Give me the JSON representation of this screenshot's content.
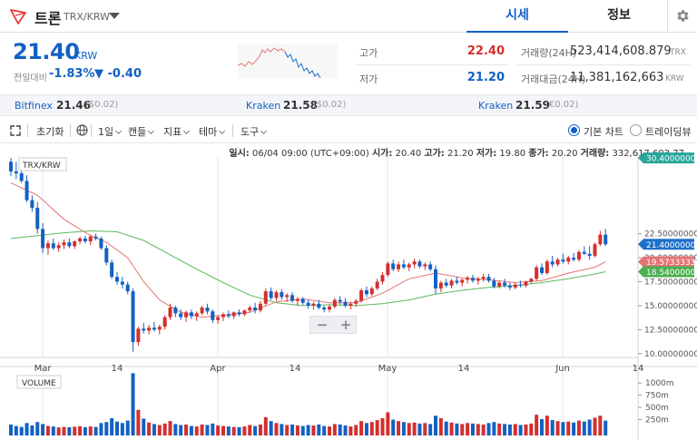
{
  "header": {
    "coin_name": "트론",
    "pair": "TRX/KRW",
    "tab_quote": "시세",
    "tab_info": "정보",
    "icons": {
      "coin": "tron-logo-icon",
      "caret": "caret-down-icon",
      "settings": "gear-icon"
    }
  },
  "summary": {
    "price": "21.40",
    "unit": "KRW",
    "prev_label": "전일대비",
    "change_pct": "-1.83%",
    "change_abs": "▼ -0.40",
    "high_label": "고가",
    "high_value": "22.40",
    "low_label": "저가",
    "low_value": "21.20",
    "volume_label": "거래량(24H)",
    "volume_value": "523,414,608.879",
    "volume_unit": "TRX",
    "amount_label": "거래대금(24H)",
    "amount_value": "11,381,162,663",
    "amount_unit": "KRW",
    "colors": {
      "up": "#d32f2f",
      "down": "#1261c4"
    }
  },
  "exchanges": [
    {
      "name": "Bitfinex",
      "price": "21.46",
      "diff": "($0.02)"
    },
    {
      "name": "Kraken",
      "price": "21.58",
      "diff": "($0.02)"
    },
    {
      "name": "Kraken",
      "price": "21.59",
      "diff": "(€0.02)"
    }
  ],
  "toolbar": {
    "reset": "초기화",
    "interval": "1일",
    "candle": "캔들",
    "indicator": "지표",
    "theme": "테마",
    "tools": "도구",
    "basic_chart": "기본 차트",
    "tradingview": "트레이딩뷰",
    "icons": {
      "expand": "expand-icon",
      "globe": "globe-icon"
    }
  },
  "ohlc": {
    "date_label": "일시:",
    "date": "06/04 09:00 (UTC+09:00)",
    "open_label": "시가:",
    "open": "20.40",
    "high_label": "고가:",
    "high": "21.20",
    "low_label": "저가:",
    "low": "19.80",
    "close_label": "종가:",
    "close": "20.20",
    "vol_label": "거래량:",
    "vol": "332,617,693.77"
  },
  "chart_data": {
    "type": "candlestick",
    "series_label": "TRX/KRW",
    "volume_label": "VOLUME",
    "y_ticks": [
      "22.50000000",
      "20.00000000",
      "17.50000000",
      "15.00000000",
      "12.50000000",
      "10.00000000"
    ],
    "y_range": [
      9.6,
      30.6
    ],
    "x_labels": [
      "Mar",
      "14",
      "Apr",
      "14",
      "May",
      "14",
      "Jun",
      "14"
    ],
    "price_tags": [
      {
        "label": "30.40000000",
        "value": 30.4,
        "color": "#26a69a"
      },
      {
        "label": "21.40000000",
        "value": 21.4,
        "color": "#1e70c9"
      },
      {
        "label": "19.57333333",
        "value": 19.57,
        "color": "#e57373"
      },
      {
        "label": "18.54000000",
        "value": 18.54,
        "color": "#4caf50"
      }
    ],
    "volume_ticks": [
      "1000m",
      "750m",
      "500m",
      "250m"
    ],
    "volume_range": [
      0,
      1300
    ],
    "candles": [
      [
        30.0,
        30.4,
        28.5,
        29.0
      ],
      [
        29.0,
        30.0,
        28.2,
        28.8
      ],
      [
        28.8,
        29.5,
        27.8,
        28.0
      ],
      [
        28.0,
        28.6,
        25.8,
        26.0
      ],
      [
        26.0,
        26.5,
        24.8,
        25.2
      ],
      [
        25.2,
        25.8,
        22.5,
        23.0
      ],
      [
        23.0,
        23.6,
        20.5,
        21.0
      ],
      [
        21.0,
        21.8,
        20.3,
        21.5
      ],
      [
        21.5,
        22.0,
        20.8,
        21.0
      ],
      [
        21.0,
        21.6,
        20.6,
        21.3
      ],
      [
        21.3,
        21.9,
        20.9,
        21.6
      ],
      [
        21.6,
        22.0,
        21.0,
        21.2
      ],
      [
        21.2,
        21.8,
        20.9,
        21.7
      ],
      [
        21.7,
        22.2,
        21.4,
        22.0
      ],
      [
        22.0,
        22.3,
        21.5,
        21.7
      ],
      [
        21.7,
        22.4,
        21.3,
        22.2
      ],
      [
        22.2,
        22.5,
        21.8,
        22.0
      ],
      [
        22.0,
        22.2,
        20.8,
        21.0
      ],
      [
        21.0,
        21.3,
        19.2,
        19.5
      ],
      [
        19.5,
        19.8,
        17.8,
        18.0
      ],
      [
        18.0,
        18.5,
        17.2,
        17.5
      ],
      [
        17.5,
        18.0,
        16.8,
        17.2
      ],
      [
        17.2,
        17.5,
        16.2,
        16.5
      ],
      [
        16.5,
        16.8,
        10.2,
        11.2
      ],
      [
        11.2,
        12.8,
        10.8,
        12.6
      ],
      [
        12.6,
        13.2,
        12.1,
        12.4
      ],
      [
        12.4,
        13.0,
        12.0,
        12.7
      ],
      [
        12.7,
        13.3,
        12.3,
        12.5
      ],
      [
        12.5,
        13.0,
        12.0,
        12.8
      ],
      [
        12.8,
        14.0,
        12.5,
        13.8
      ],
      [
        13.8,
        15.2,
        13.5,
        14.8
      ],
      [
        14.8,
        15.0,
        13.8,
        14.2
      ],
      [
        14.2,
        14.6,
        13.5,
        13.8
      ],
      [
        13.8,
        14.5,
        13.3,
        14.3
      ],
      [
        14.3,
        14.6,
        13.6,
        13.9
      ],
      [
        13.9,
        14.4,
        13.4,
        14.2
      ],
      [
        14.2,
        15.0,
        14.0,
        14.8
      ],
      [
        14.8,
        15.2,
        14.1,
        14.4
      ],
      [
        14.4,
        14.6,
        13.2,
        13.5
      ],
      [
        13.5,
        14.0,
        13.1,
        13.8
      ],
      [
        13.8,
        14.3,
        13.4,
        14.1
      ],
      [
        14.1,
        14.5,
        13.7,
        13.9
      ],
      [
        13.9,
        14.4,
        13.6,
        14.3
      ],
      [
        14.3,
        14.6,
        13.9,
        14.1
      ],
      [
        14.1,
        14.6,
        13.9,
        14.5
      ],
      [
        14.5,
        15.0,
        14.3,
        14.8
      ],
      [
        14.8,
        15.3,
        14.2,
        14.5
      ],
      [
        14.5,
        15.5,
        14.3,
        15.2
      ],
      [
        15.2,
        16.8,
        15.0,
        16.5
      ],
      [
        16.5,
        16.9,
        15.6,
        15.8
      ],
      [
        15.8,
        16.6,
        15.5,
        16.4
      ],
      [
        16.4,
        16.7,
        15.6,
        15.9
      ],
      [
        15.9,
        16.3,
        15.4,
        16.1
      ],
      [
        16.1,
        16.4,
        15.3,
        15.5
      ],
      [
        15.5,
        15.9,
        15.0,
        15.7
      ],
      [
        15.7,
        15.9,
        15.1,
        15.3
      ],
      [
        15.3,
        15.6,
        14.7,
        15.0
      ],
      [
        15.0,
        15.4,
        14.6,
        15.2
      ],
      [
        15.2,
        15.6,
        14.6,
        14.8
      ],
      [
        14.8,
        15.0,
        14.3,
        14.6
      ],
      [
        14.6,
        15.1,
        14.3,
        14.9
      ],
      [
        14.9,
        15.8,
        14.7,
        15.6
      ],
      [
        15.6,
        16.0,
        15.1,
        15.4
      ],
      [
        15.4,
        15.8,
        14.8,
        15.0
      ],
      [
        15.0,
        15.4,
        14.6,
        15.2
      ],
      [
        15.2,
        15.7,
        14.9,
        15.5
      ],
      [
        15.5,
        16.8,
        15.3,
        16.6
      ],
      [
        16.6,
        17.0,
        15.9,
        16.2
      ],
      [
        16.2,
        17.0,
        16.0,
        16.8
      ],
      [
        16.8,
        17.8,
        16.6,
        17.5
      ],
      [
        17.5,
        18.5,
        17.2,
        18.2
      ],
      [
        18.2,
        19.6,
        18.0,
        19.4
      ],
      [
        19.4,
        19.8,
        18.6,
        18.8
      ],
      [
        18.8,
        19.6,
        18.5,
        19.3
      ],
      [
        19.3,
        19.8,
        18.8,
        19.0
      ],
      [
        19.0,
        19.5,
        18.6,
        19.3
      ],
      [
        19.3,
        19.9,
        18.9,
        19.6
      ],
      [
        19.6,
        19.8,
        18.9,
        19.1
      ],
      [
        19.1,
        19.5,
        18.7,
        19.3
      ],
      [
        19.3,
        19.6,
        18.6,
        18.8
      ],
      [
        18.8,
        19.2,
        16.2,
        16.8
      ],
      [
        16.8,
        17.6,
        16.4,
        17.4
      ],
      [
        17.4,
        17.8,
        16.9,
        17.1
      ],
      [
        17.1,
        17.8,
        16.8,
        17.6
      ],
      [
        17.6,
        18.0,
        17.2,
        17.4
      ],
      [
        17.4,
        17.8,
        17.0,
        17.7
      ],
      [
        17.7,
        18.1,
        17.3,
        17.9
      ],
      [
        17.9,
        18.2,
        17.4,
        17.6
      ],
      [
        17.6,
        18.0,
        17.2,
        17.8
      ],
      [
        17.8,
        18.3,
        17.5,
        18.0
      ],
      [
        18.0,
        18.3,
        17.4,
        17.6
      ],
      [
        17.6,
        17.9,
        16.8,
        17.0
      ],
      [
        17.0,
        17.6,
        16.8,
        17.4
      ],
      [
        17.4,
        17.8,
        16.9,
        17.1
      ],
      [
        17.1,
        17.4,
        16.6,
        16.9
      ],
      [
        16.9,
        17.4,
        16.7,
        17.2
      ],
      [
        17.2,
        17.6,
        16.9,
        17.1
      ],
      [
        17.1,
        17.6,
        16.9,
        17.5
      ],
      [
        17.5,
        17.9,
        17.3,
        17.8
      ],
      [
        17.8,
        19.2,
        17.6,
        19.0
      ],
      [
        19.0,
        19.4,
        18.2,
        18.4
      ],
      [
        18.4,
        19.8,
        18.2,
        19.6
      ],
      [
        19.6,
        20.2,
        19.0,
        19.3
      ],
      [
        19.3,
        20.0,
        19.1,
        19.8
      ],
      [
        19.8,
        20.4,
        19.4,
        19.6
      ],
      [
        19.6,
        20.2,
        19.3,
        20.0
      ],
      [
        20.0,
        20.5,
        19.6,
        19.8
      ],
      [
        19.8,
        20.8,
        19.6,
        20.6
      ],
      [
        20.6,
        21.2,
        20.3,
        20.4
      ],
      [
        20.4,
        21.2,
        19.8,
        20.2
      ],
      [
        20.2,
        21.6,
        20.0,
        21.4
      ],
      [
        21.4,
        22.8,
        21.2,
        22.4
      ],
      [
        22.4,
        23.0,
        21.2,
        21.4
      ]
    ],
    "volumes": [
      150,
      120,
      100,
      180,
      130,
      200,
      160,
      120,
      110,
      90,
      100,
      95,
      105,
      115,
      95,
      110,
      100,
      180,
      200,
      280,
      210,
      180,
      230,
      1200,
      450,
      270,
      190,
      160,
      140,
      170,
      220,
      160,
      140,
      150,
      120,
      110,
      150,
      140,
      170,
      130,
      120,
      110,
      100,
      95,
      110,
      140,
      120,
      150,
      300,
      220,
      180,
      160,
      140,
      150,
      130,
      120,
      140,
      130,
      150,
      120,
      110,
      160,
      150,
      130,
      110,
      140,
      220,
      180,
      200,
      240,
      280,
      400,
      250,
      220,
      200,
      180,
      190,
      170,
      180,
      160,
      330,
      280,
      210,
      190,
      170,
      160,
      180,
      170,
      160,
      150,
      180,
      200,
      170,
      160,
      150,
      160,
      140,
      150,
      170,
      350,
      260,
      330,
      240,
      220,
      200,
      210,
      190,
      230,
      210,
      250,
      290,
      330,
      230
    ],
    "ma_red": [
      [
        0,
        27.8
      ],
      [
        5,
        26.5
      ],
      [
        10,
        24.0
      ],
      [
        15,
        22.3
      ],
      [
        18,
        21.6
      ],
      [
        22,
        20.0
      ],
      [
        25,
        17.5
      ],
      [
        28,
        15.6
      ],
      [
        32,
        14.3
      ],
      [
        36,
        13.8
      ],
      [
        40,
        14.0
      ],
      [
        45,
        14.3
      ],
      [
        50,
        15.4
      ],
      [
        55,
        15.7
      ],
      [
        60,
        15.3
      ],
      [
        65,
        15.3
      ],
      [
        70,
        16.3
      ],
      [
        75,
        17.8
      ],
      [
        80,
        18.4
      ],
      [
        85,
        17.9
      ],
      [
        90,
        17.7
      ],
      [
        95,
        17.4
      ],
      [
        100,
        17.6
      ],
      [
        105,
        18.4
      ],
      [
        110,
        19.0
      ],
      [
        112,
        19.57
      ]
    ],
    "ma_green": [
      [
        0,
        22.0
      ],
      [
        10,
        22.6
      ],
      [
        15,
        22.8
      ],
      [
        20,
        22.7
      ],
      [
        25,
        21.8
      ],
      [
        30,
        20.3
      ],
      [
        35,
        18.8
      ],
      [
        40,
        17.4
      ],
      [
        45,
        16.1
      ],
      [
        50,
        15.3
      ],
      [
        55,
        15.0
      ],
      [
        60,
        15.1
      ],
      [
        65,
        15.0
      ],
      [
        70,
        15.2
      ],
      [
        75,
        15.6
      ],
      [
        80,
        16.2
      ],
      [
        85,
        16.6
      ],
      [
        90,
        16.9
      ],
      [
        95,
        17.1
      ],
      [
        100,
        17.4
      ],
      [
        105,
        17.8
      ],
      [
        110,
        18.3
      ],
      [
        112,
        18.54
      ]
    ]
  }
}
